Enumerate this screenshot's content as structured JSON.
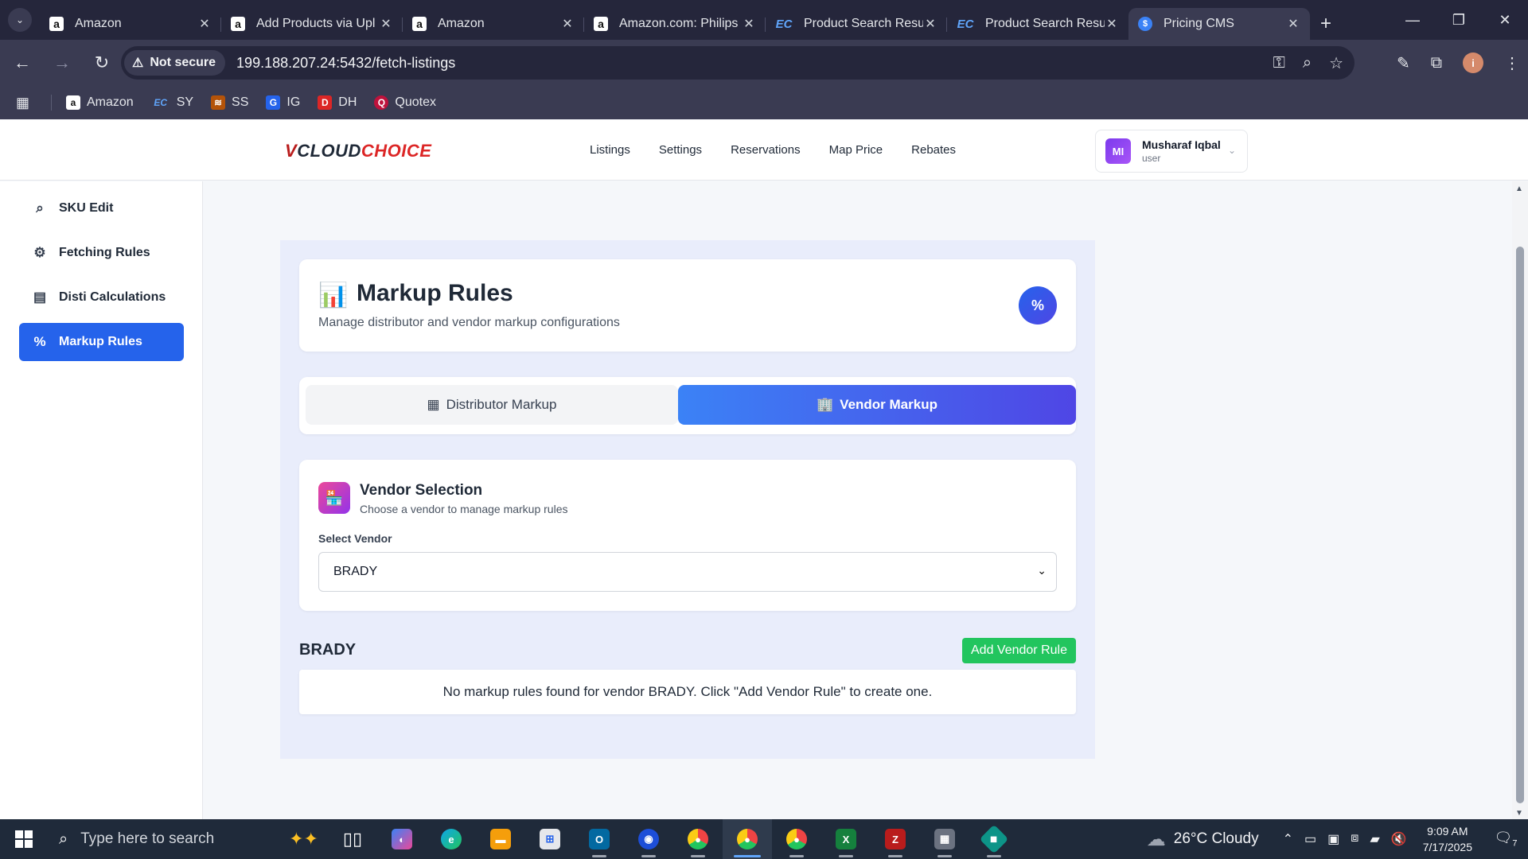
{
  "browser": {
    "tabs": [
      {
        "title": "Amazon",
        "favicon": "amazon-icon",
        "active": false
      },
      {
        "title": "Add Products via Upl",
        "favicon": "amazon-icon",
        "active": false
      },
      {
        "title": "Amazon",
        "favicon": "amazon-icon",
        "active": false
      },
      {
        "title": "Amazon.com: Philips",
        "favicon": "amazon-icon",
        "active": false
      },
      {
        "title": "Product Search Resul",
        "favicon": "ec-icon",
        "active": false
      },
      {
        "title": "Product Search Resul",
        "favicon": "ec-icon",
        "active": false
      },
      {
        "title": "Pricing CMS",
        "favicon": "pricing-cms-icon",
        "active": true
      }
    ],
    "security_label": "Not secure",
    "url": "199.188.207.24:5432/fetch-listings",
    "bookmarks": [
      {
        "label": "Amazon",
        "icon": "amazon-icon"
      },
      {
        "label": "SY",
        "icon": "ec-icon"
      },
      {
        "label": "SS",
        "icon": "ss-icon"
      },
      {
        "label": "IG",
        "icon": "ig-icon"
      },
      {
        "label": "DH",
        "icon": "dh-icon"
      },
      {
        "label": "Quotex",
        "icon": "quotex-icon"
      }
    ]
  },
  "app": {
    "logo": {
      "v": "V",
      "cloud": "CLOUD",
      "choice": "CHOICE"
    },
    "nav": [
      "Listings",
      "Settings",
      "Reservations",
      "Map Price",
      "Rebates"
    ],
    "user": {
      "initials": "MI",
      "name": "Musharaf Iqbal",
      "role": "user"
    },
    "sidebar": [
      {
        "label": "SKU Edit",
        "icon": "search-icon",
        "active": false
      },
      {
        "label": "Fetching Rules",
        "icon": "gear-icon",
        "active": false
      },
      {
        "label": "Disti Calculations",
        "icon": "calculator-icon",
        "active": false
      },
      {
        "label": "Markup Rules",
        "icon": "percent-icon",
        "active": true
      }
    ]
  },
  "main": {
    "title": "Markup Rules",
    "subtitle": "Manage distributor and vendor markup configurations",
    "badge": "%",
    "tabs": [
      {
        "label": "Distributor Markup",
        "active": false
      },
      {
        "label": "Vendor Markup",
        "active": true
      }
    ],
    "vendor_selection": {
      "title": "Vendor Selection",
      "subtitle": "Choose a vendor to manage markup rules",
      "select_label": "Select Vendor",
      "selected": "BRADY"
    },
    "vendor_heading": "BRADY",
    "add_button": "Add Vendor Rule",
    "empty_message": "No markup rules found for vendor BRADY. Click \"Add Vendor Rule\" to create one."
  },
  "taskbar": {
    "search_placeholder": "Type here to search",
    "weather": "26°C  Cloudy",
    "time": "9:09 AM",
    "date": "7/17/2025",
    "notification_count": "7"
  },
  "colors": {
    "accent": "#2563eb",
    "vendor_tab_gradient": [
      "#3b82f6",
      "#4f46e5"
    ],
    "add_button": "#22c55e",
    "panel_bg": "#e9edfb"
  }
}
